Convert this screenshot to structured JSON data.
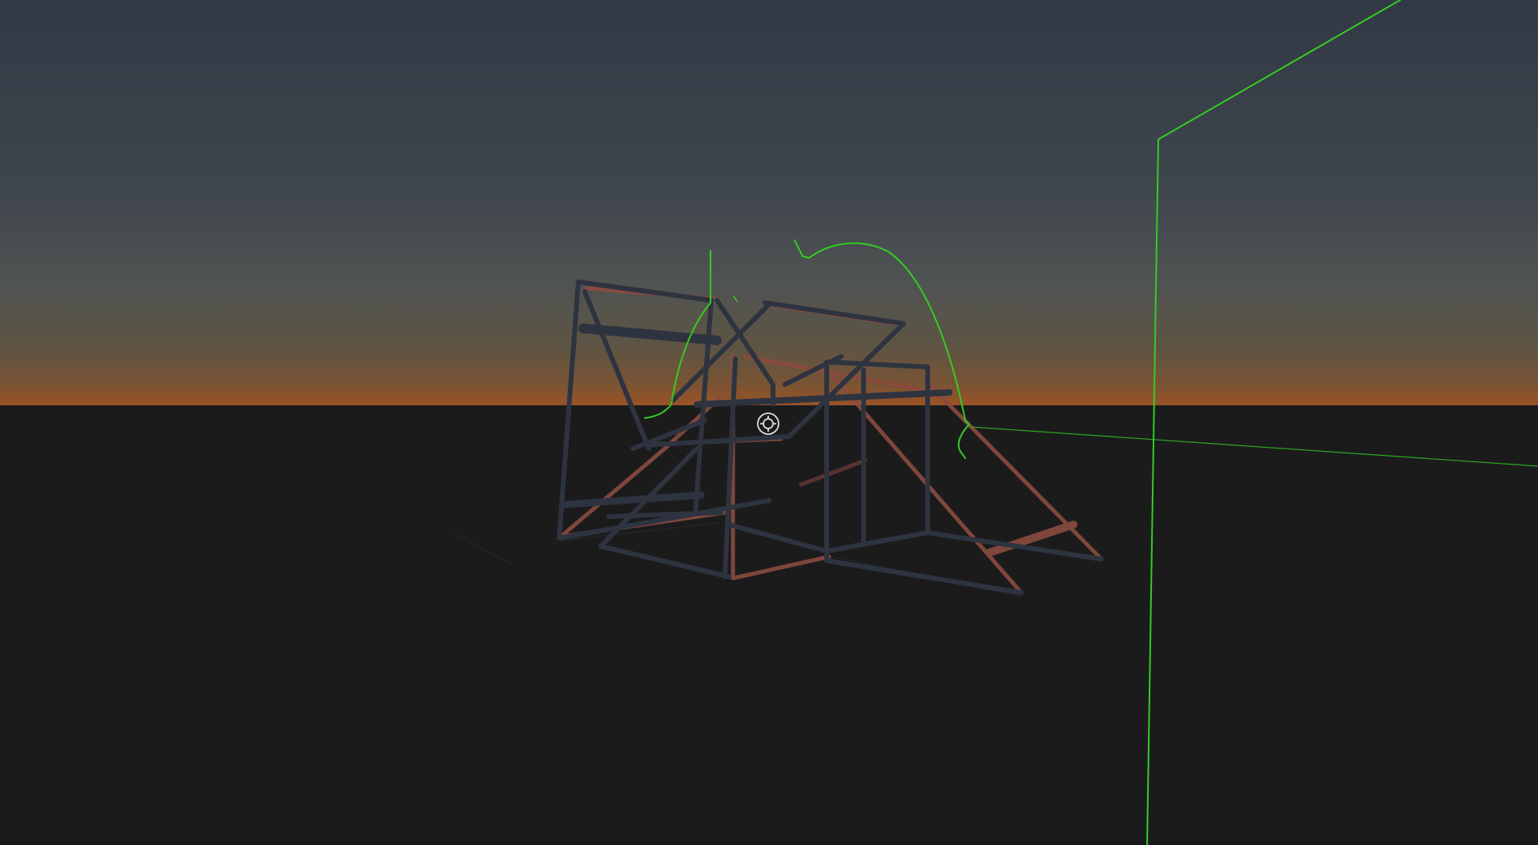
{
  "scene": {
    "sky_colors": {
      "zenith": "#323945",
      "mid": "#4a5155",
      "horizon_glow": "#8a5a33",
      "horizon_edge": "#9b5326"
    },
    "ground_color": "#1b1b1c",
    "frame_colors": {
      "dark_frame": "#2e3340",
      "red_frame": "#8a4b40"
    },
    "debug_line_color": "#33cc22"
  },
  "hud": {
    "crosshair_icon": "crosshair-icon",
    "crosshair_color": "#d8dde2"
  }
}
